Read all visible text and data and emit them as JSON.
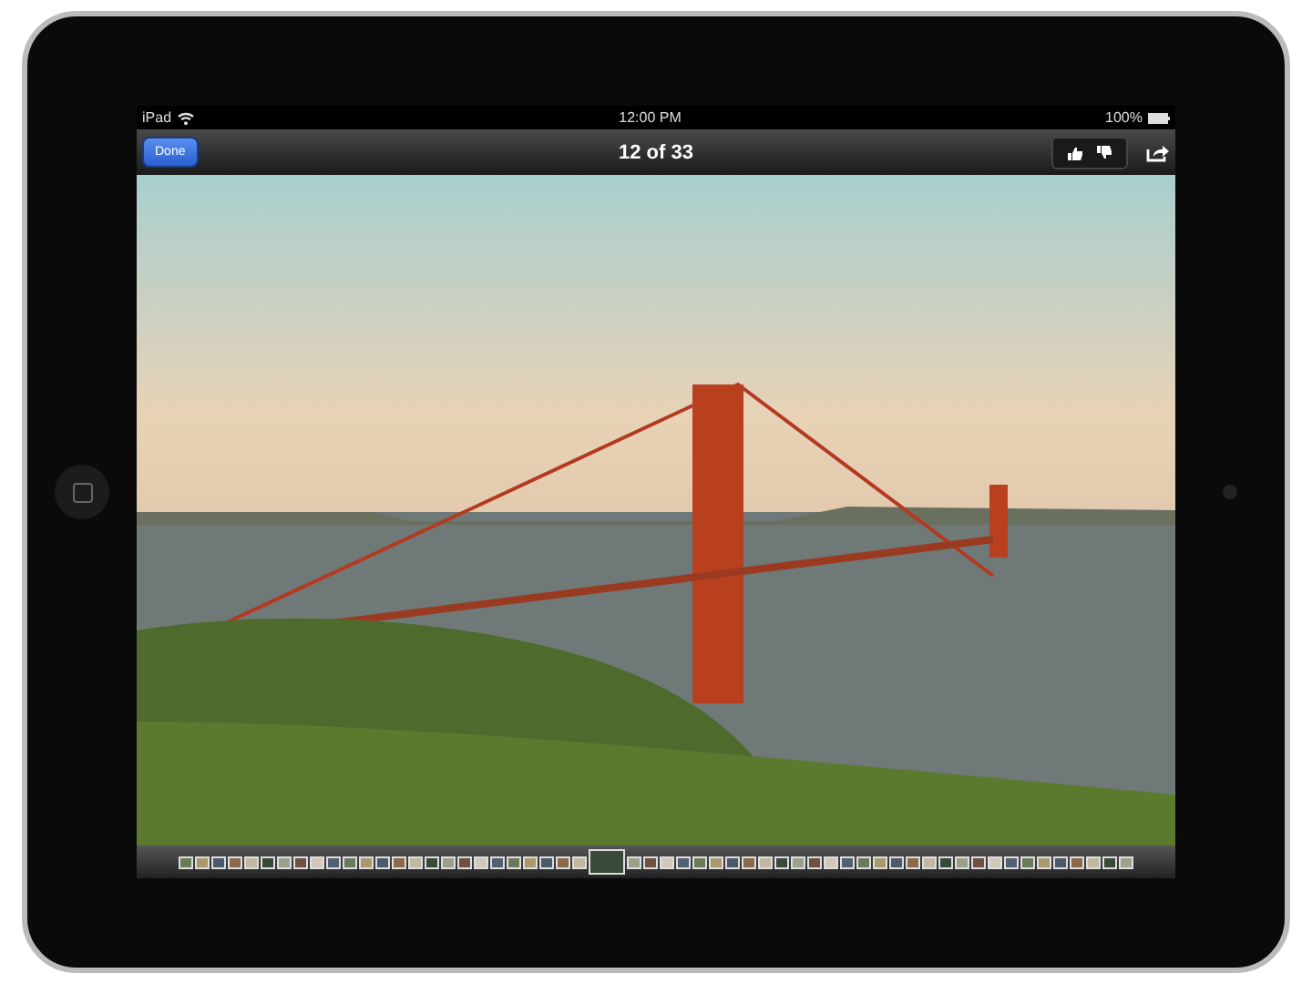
{
  "status_bar": {
    "carrier": "iPad",
    "time": "12:00 PM",
    "battery": "100%"
  },
  "nav_bar": {
    "done_button": "Done",
    "title": "12 of 33"
  },
  "thumbnails": [
    {
      "selected": false
    },
    {
      "selected": false
    },
    {
      "selected": false
    },
    {
      "selected": false
    },
    {
      "selected": false
    },
    {
      "selected": false
    },
    {
      "selected": false
    },
    {
      "selected": false
    },
    {
      "selected": false
    },
    {
      "selected": false
    },
    {
      "selected": false
    },
    {
      "selected": false
    },
    {
      "selected": false
    },
    {
      "selected": false
    },
    {
      "selected": false
    },
    {
      "selected": false
    },
    {
      "selected": false
    },
    {
      "selected": false
    },
    {
      "selected": false
    },
    {
      "selected": false
    },
    {
      "selected": false
    },
    {
      "selected": false
    },
    {
      "selected": false
    },
    {
      "selected": false
    },
    {
      "selected": false
    },
    {
      "selected": true
    },
    {
      "selected": false
    },
    {
      "selected": false
    },
    {
      "selected": false
    },
    {
      "selected": false
    },
    {
      "selected": false
    },
    {
      "selected": false
    },
    {
      "selected": false
    },
    {
      "selected": false
    },
    {
      "selected": false
    },
    {
      "selected": false
    },
    {
      "selected": false
    },
    {
      "selected": false
    },
    {
      "selected": false
    },
    {
      "selected": false
    },
    {
      "selected": false
    },
    {
      "selected": false
    },
    {
      "selected": false
    },
    {
      "selected": false
    },
    {
      "selected": false
    },
    {
      "selected": false
    },
    {
      "selected": false
    },
    {
      "selected": false
    },
    {
      "selected": false
    },
    {
      "selected": false
    },
    {
      "selected": false
    },
    {
      "selected": false
    },
    {
      "selected": false
    },
    {
      "selected": false
    },
    {
      "selected": false
    },
    {
      "selected": false
    },
    {
      "selected": false
    }
  ]
}
